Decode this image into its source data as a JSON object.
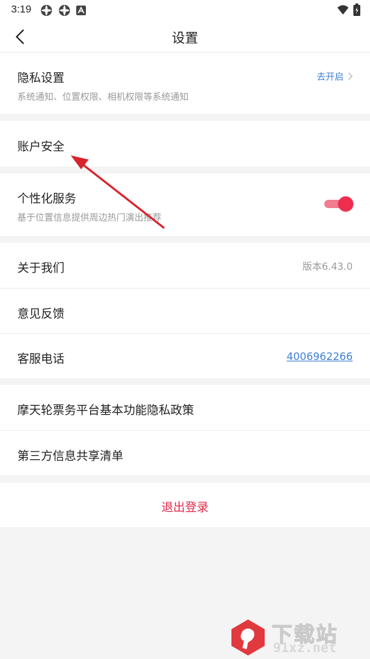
{
  "status": {
    "time": "3:19"
  },
  "nav": {
    "title": "设置"
  },
  "privacy": {
    "title": "隐私设置",
    "subtitle": "系统通知、位置权限、相机权限等系统通知",
    "action": "去开启"
  },
  "account": {
    "title": "账户安全"
  },
  "personal": {
    "title": "个性化服务",
    "subtitle": "基于位置信息提供周边热门演出推荐",
    "enabled": true
  },
  "about": {
    "title": "关于我们",
    "version": "版本6.43.0"
  },
  "feedback": {
    "title": "意见反馈"
  },
  "service": {
    "title": "客服电话",
    "phone": "4006962266"
  },
  "policy": {
    "title": "摩天轮票务平台基本功能隐私政策"
  },
  "third_party": {
    "title": "第三方信息共享清单"
  },
  "logout": {
    "label": "退出登录"
  },
  "watermark": {
    "brand": "下载站",
    "url": "91xz.net"
  },
  "colors": {
    "accent": "#ef2d4e",
    "link": "#3d7fd5",
    "arrow": "#d9232d"
  }
}
